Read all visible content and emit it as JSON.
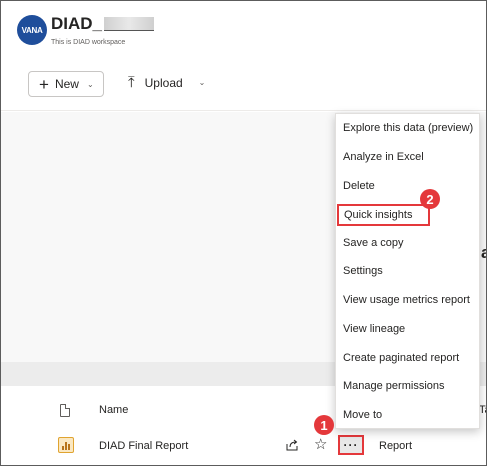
{
  "workspace": {
    "logo_text": "VANA",
    "title": "DIAD_",
    "subtitle": "This is DIAD workspace",
    "logo_color": "#1f4e9b"
  },
  "toolbar": {
    "new_label": "New",
    "upload_label": "Upload"
  },
  "list": {
    "column_name": "Name",
    "column_type_cut": "Ta",
    "rows": [
      {
        "name": "DIAD Final Report",
        "type": "Report",
        "icon": "report-bar-chart-icon"
      }
    ]
  },
  "side_text_cut": "a",
  "menu": {
    "items": [
      "Explore this data (preview)",
      "Analyze in Excel",
      "Delete",
      "Quick insights",
      "Save a copy",
      "Settings",
      "View usage metrics report",
      "View lineage",
      "Create paginated report",
      "Manage permissions",
      "Move to"
    ],
    "highlighted_index": 3
  },
  "annotations": {
    "step1": "1",
    "step2": "2",
    "highlight_color": "#e4383b"
  }
}
